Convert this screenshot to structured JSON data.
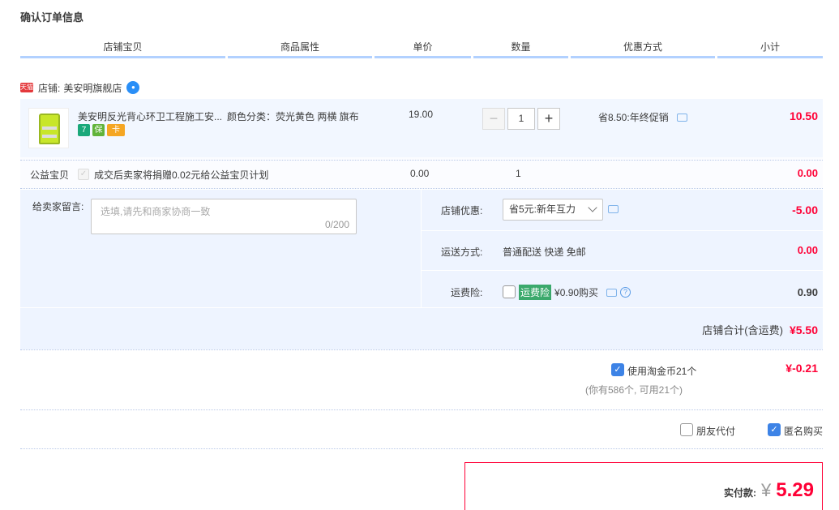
{
  "title": "确认订单信息",
  "columns": [
    "店铺宝贝",
    "商品属性",
    "单价",
    "数量",
    "优惠方式",
    "小计"
  ],
  "shop": {
    "badge": "天猫",
    "label": "店铺:",
    "name": "美安明旗舰店"
  },
  "item": {
    "title": "美安明反光背心环卫工程施工安...",
    "property": "颜色分类：荧光黄色 两横 旗布",
    "price": "19.00",
    "quantity": "1",
    "promo": "省8.50:年终促销",
    "subtotal": "10.50",
    "service_icons": [
      "7",
      "保",
      "卡"
    ]
  },
  "charity": {
    "label": "公益宝贝",
    "text": "成交后卖家将捐赠0.02元给公益宝贝计划",
    "price": "0.00",
    "quantity": "1",
    "subtotal": "0.00"
  },
  "memo": {
    "label": "给卖家留言:",
    "placeholder": "选填,请先和商家协商一致",
    "count": "0/200"
  },
  "shop_discount": {
    "label": "店铺优惠:",
    "selected": "省5元:新年互力",
    "value": "-5.00"
  },
  "shipping": {
    "label": "运送方式:",
    "method": "普通配送 快递 免邮",
    "value": "0.00"
  },
  "freight_insurance": {
    "label": "运费险:",
    "tag": "运费险",
    "text": "¥0.90购买",
    "value": "0.90"
  },
  "shop_total": {
    "label": "店铺合计(含运费)",
    "value": "¥5.50"
  },
  "coins": {
    "label": "使用淘金币21个",
    "note": "(你有586个, 可用21个)",
    "value": "¥-0.21"
  },
  "options": {
    "friend_pay": "朋友代付",
    "anonymous": "匿名购买"
  },
  "payment": {
    "label": "实付款:",
    "currency": "¥",
    "amount": "5.29"
  },
  "colors": {
    "accent_red": "#ff0036",
    "header_line": "#b2d1ff",
    "panel_bg": "#eef4ff",
    "checkbox_blue": "#3d83e6"
  }
}
